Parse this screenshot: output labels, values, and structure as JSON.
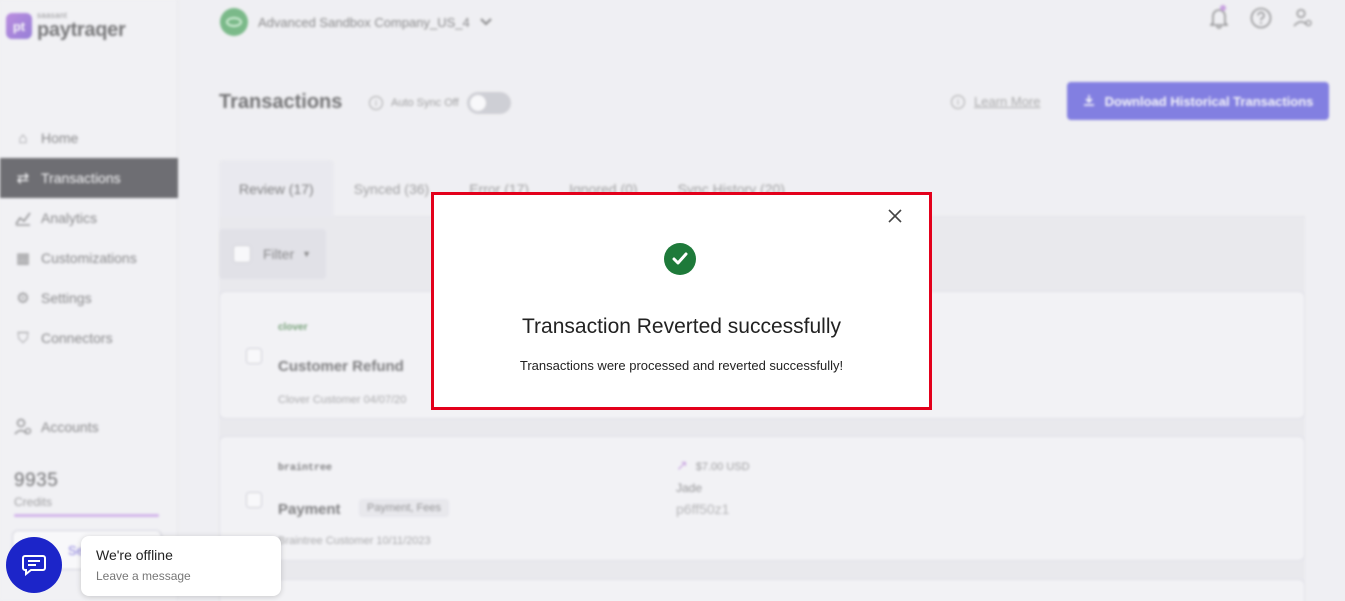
{
  "brand": {
    "sub": "saasant",
    "name": "paytraqer",
    "mark": "pt"
  },
  "sidebar": {
    "items": [
      {
        "label": "Home",
        "icon": "home-icon",
        "glyph": "⌂"
      },
      {
        "label": "Transactions",
        "icon": "transfer-arrows-icon",
        "glyph": "⇄"
      },
      {
        "label": "Analytics",
        "icon": "chart-icon",
        "glyph": "📈"
      },
      {
        "label": "Customizations",
        "icon": "grid-icon",
        "glyph": "▦"
      },
      {
        "label": "Settings",
        "icon": "gear-icon",
        "glyph": "⚙"
      },
      {
        "label": "Connectors",
        "icon": "plug-icon",
        "glyph": "⛉"
      }
    ],
    "accounts": {
      "label": "Accounts",
      "icon": "users-icon",
      "glyph": "👤"
    },
    "credits": {
      "value": "9935",
      "label": "Credits"
    },
    "button_label": "Se"
  },
  "topbar": {
    "company": "Advanced Sandbox Company_US_4"
  },
  "page": {
    "title": "Transactions",
    "auto_sync": "Auto Sync Off",
    "learn_more": "Learn More",
    "download": "Download Historical Transactions"
  },
  "tabs": [
    {
      "label": "Review (17)",
      "active": true
    },
    {
      "label": "Synced (36)"
    },
    {
      "label": "Error (17)"
    },
    {
      "label": "Ignored (0)"
    },
    {
      "label": "Sync History (20)"
    }
  ],
  "filter": {
    "label": "Filter"
  },
  "cards": [
    {
      "brand": "clover",
      "type": "Customer Refund",
      "meta": "Clover Customer  04/07/20"
    },
    {
      "brand": "braintree",
      "type": "Payment",
      "tag": "Payment, Fees",
      "meta": "Braintree Customer  10/11/2023",
      "amount": "$7.00 USD",
      "payer": "Jade",
      "ref": "p6ff50z1"
    }
  ],
  "modal": {
    "title": "Transaction Reverted successfully",
    "message": "Transactions were processed and reverted successfully!"
  },
  "chat": {
    "title": "We're offline",
    "subtitle": "Leave a message"
  },
  "colors": {
    "accent": "#4b46d9",
    "success": "#1e7a3a",
    "highlight": "#e3001b",
    "chat": "#1c25c9"
  }
}
